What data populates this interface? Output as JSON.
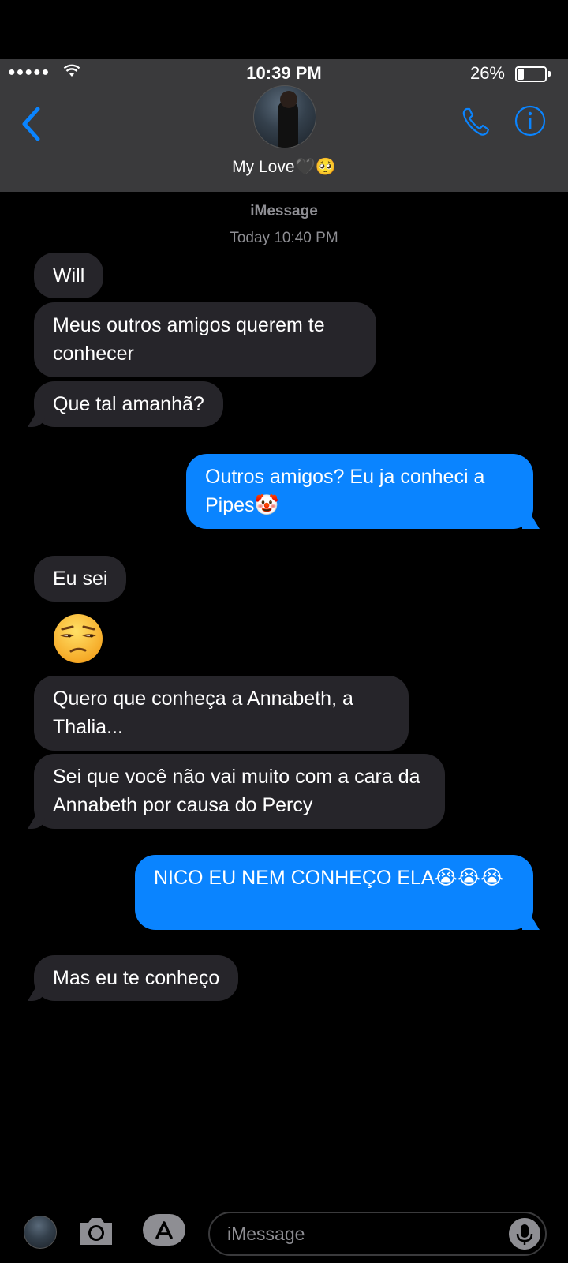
{
  "status_bar": {
    "signal": "●●●●●",
    "time": "10:39 PM",
    "battery_percent": "26%",
    "battery_level": 0.26
  },
  "header": {
    "contact_name": "My Love🖤🥺",
    "avatar_icon": "contact-photo",
    "back_icon": "chevron-left-icon",
    "call_icon": "phone-icon",
    "info_icon": "info-icon"
  },
  "conversation": {
    "service": "iMessage",
    "timestamp": "Today 10:40 PM",
    "messages": [
      {
        "from": "them",
        "text": "Will"
      },
      {
        "from": "them",
        "text": "Meus outros amigos querem te conhecer"
      },
      {
        "from": "them",
        "text": "Que tal amanhã?"
      },
      {
        "from": "me",
        "text": "Outros amigos? Eu ja conheci a Pipes🤡"
      },
      {
        "from": "them",
        "text": "Eu sei"
      },
      {
        "from": "them",
        "text": "😒"
      },
      {
        "from": "them",
        "text": "Quero que conheça a Annabeth, a Thalia..."
      },
      {
        "from": "them",
        "text": "Sei que você não vai muito com a cara da Annabeth por causa do Percy"
      },
      {
        "from": "me",
        "text": "NICO EU NEM CONHEÇO ELA😭😭😭"
      },
      {
        "from": "them",
        "text": "Mas eu te conheço"
      }
    ]
  },
  "toolbar": {
    "input_placeholder": "iMessage",
    "camera_icon": "camera-icon",
    "apps_icon": "app-store-icon",
    "mic_icon": "microphone-icon"
  },
  "colors": {
    "background": "#000000",
    "header": "#3a3a3c",
    "incoming_bubble": "#26252a",
    "outgoing_bubble": "#0a84ff",
    "accent": "#0a84ff",
    "secondary_text": "#8e8e93"
  }
}
